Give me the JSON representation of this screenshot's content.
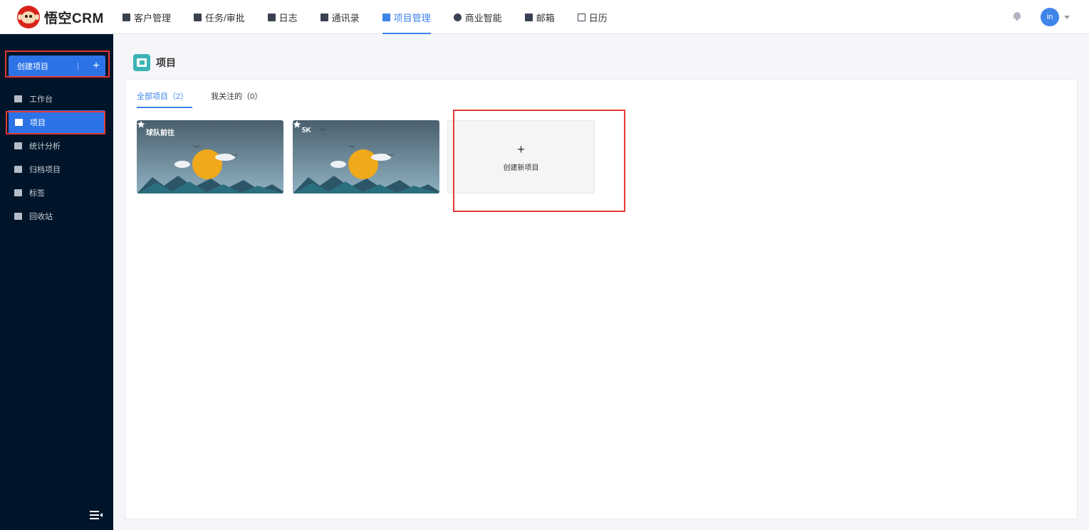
{
  "app": {
    "brand": "悟空CRM"
  },
  "nav": {
    "items": [
      {
        "label": "客户管理",
        "icon": "building-icon"
      },
      {
        "label": "任务/审批",
        "icon": "briefcase-icon"
      },
      {
        "label": "日志",
        "icon": "document-icon"
      },
      {
        "label": "通讯录",
        "icon": "contacts-icon"
      },
      {
        "label": "项目管理",
        "icon": "project-icon",
        "active": true
      },
      {
        "label": "商业智能",
        "icon": "shield-check-icon"
      },
      {
        "label": "邮箱",
        "icon": "mail-icon"
      },
      {
        "label": "日历",
        "icon": "calendar-icon"
      }
    ]
  },
  "user": {
    "avatar_text": "in"
  },
  "sidebar": {
    "create_label": "创建项目",
    "create_plus": "+",
    "items": [
      {
        "label": "工作台",
        "icon": "monitor-icon"
      },
      {
        "label": "项目",
        "icon": "project-icon",
        "active": true
      },
      {
        "label": "统计分析",
        "icon": "bar-chart-icon"
      },
      {
        "label": "归档项目",
        "icon": "archive-icon"
      },
      {
        "label": "标签",
        "icon": "tag-icon"
      },
      {
        "label": "回收站",
        "icon": "trash-icon"
      }
    ]
  },
  "page": {
    "title": "项目",
    "tabs": [
      {
        "label": "全部项目（2）",
        "active": true
      },
      {
        "label": "我关注的（0）"
      }
    ],
    "projects": [
      {
        "name": "球队前往"
      },
      {
        "name": "5K"
      }
    ],
    "new_project": {
      "plus": "+",
      "label": "创建新项目"
    }
  },
  "colors": {
    "accent": "#3e84e9",
    "sidebar_bg": "#001529",
    "highlight": "#e53935",
    "card_sky": "#5c7585",
    "sun": "#f0a91a"
  }
}
